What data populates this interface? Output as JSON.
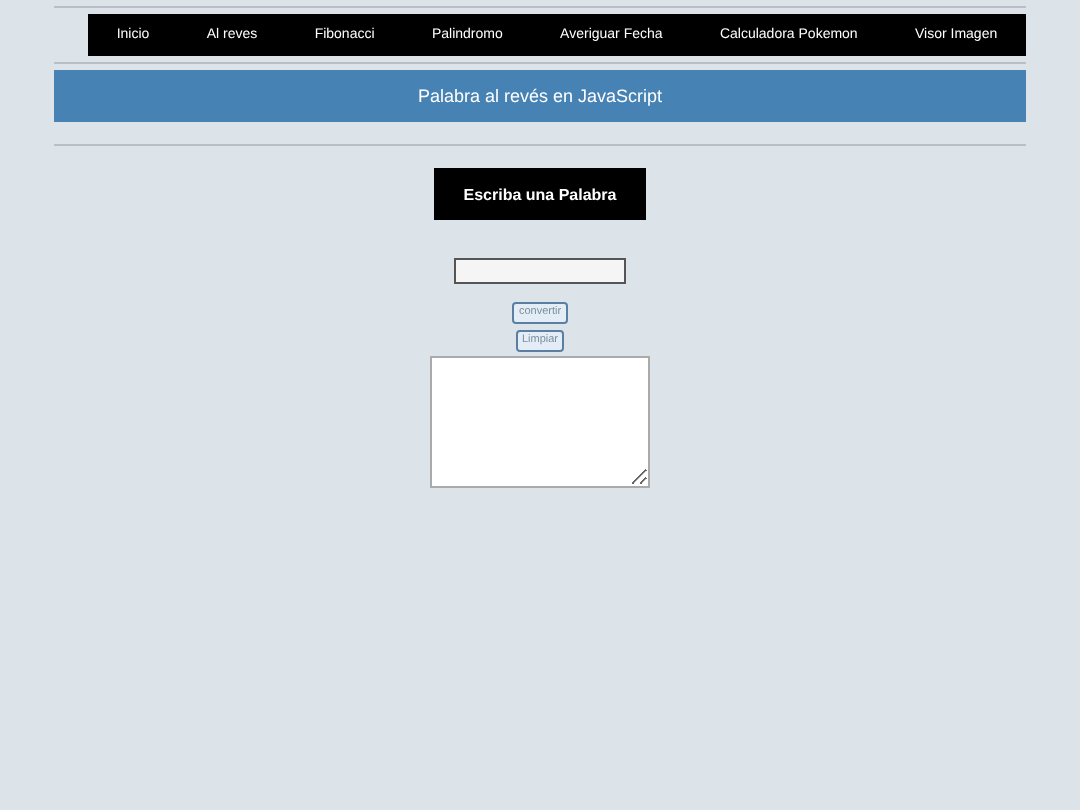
{
  "nav": [
    {
      "label": "Inicio"
    },
    {
      "label": "Al reves"
    },
    {
      "label": "Fibonacci"
    },
    {
      "label": "Palindromo"
    },
    {
      "label": "Averiguar Fecha"
    },
    {
      "label": "Calculadora Pokemon"
    },
    {
      "label": "Visor Imagen"
    }
  ],
  "banner": {
    "title": "Palabra al revés en JavaScript"
  },
  "form": {
    "heading": "Escriba una Palabra",
    "buttons": [
      "convertir",
      "Limpiar"
    ]
  }
}
